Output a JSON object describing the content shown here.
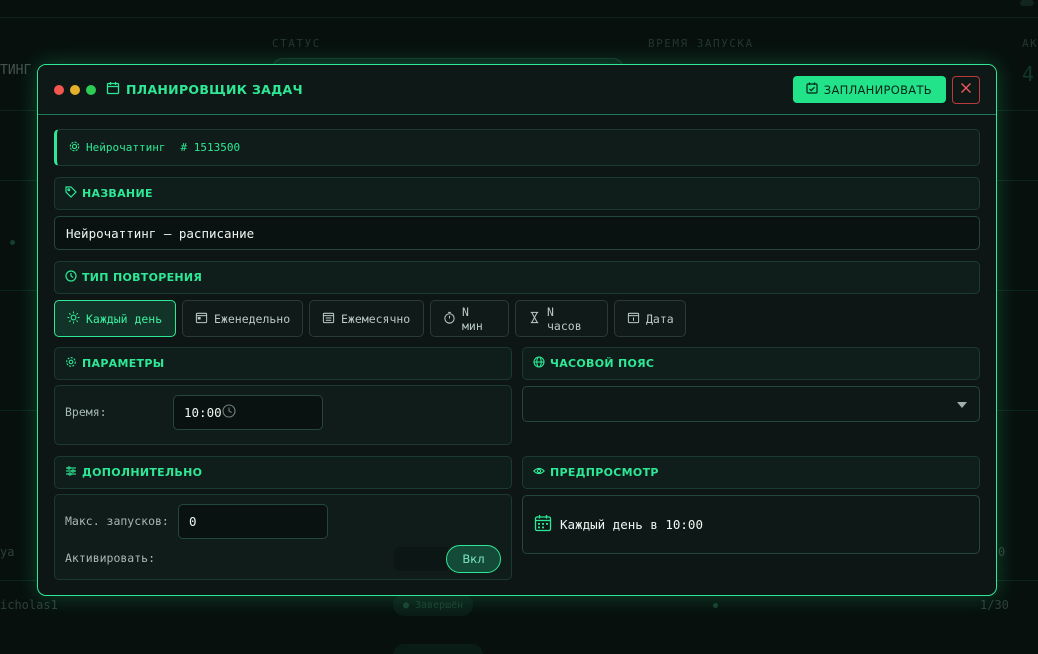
{
  "background": {
    "col_status": "СТАТУС",
    "col_launch_time": "ВРЕМЯ ЗАПУСКА",
    "col_active_partial": "АК",
    "left_partial_1": "ТИНГ",
    "row_name_partial_1": "ya",
    "row_name_partial_2": "icholas1",
    "row_status": "● Завершён",
    "row_count": "1/30",
    "row_count_top": "0"
  },
  "modal": {
    "title": "ПЛАНИРОВЩИК ЗАДАЧ",
    "schedule_button": "ЗАПЛАНИРОВАТЬ",
    "task_name": "Нейрочаттинг",
    "task_number": "# 1513500",
    "name_section": "НАЗВАНИЕ",
    "name_value": "Нейрочаттинг — расписание",
    "repeat_section": "ТИП ПОВТОРЕНИЯ",
    "repeat_options": [
      {
        "label": "Каждый день",
        "icon": "sun-icon",
        "active": true
      },
      {
        "label": "Еженедельно",
        "icon": "calendar-week-icon",
        "active": false
      },
      {
        "label": "Ежемесячно",
        "icon": "calendar-month-icon",
        "active": false
      },
      {
        "label": "N мин",
        "icon": "stopwatch-icon",
        "active": false
      },
      {
        "label": "N часов",
        "icon": "hourglass-icon",
        "active": false
      },
      {
        "label": "Дата",
        "icon": "calendar-date-icon",
        "active": false
      }
    ],
    "params_section": "ПАРАМЕТРЫ",
    "time_label": "Время:",
    "time_value": "10:00",
    "timezone_section": "ЧАСОВОЙ ПОЯС",
    "timezone_value": "",
    "extra_section": "ДОПОЛНИТЕЛЬНО",
    "max_runs_label": "Макс. запусков:",
    "max_runs_value": "0",
    "activate_label": "Активировать:",
    "activate_toggle": "Вкл",
    "preview_section": "ПРЕДПРОСМОТР",
    "preview_text": "Каждый день в 10:00"
  },
  "colors": {
    "accent": "#2ee896",
    "background": "#0a1412",
    "panel": "#0f1c19",
    "close_red": "#b73b3b"
  }
}
